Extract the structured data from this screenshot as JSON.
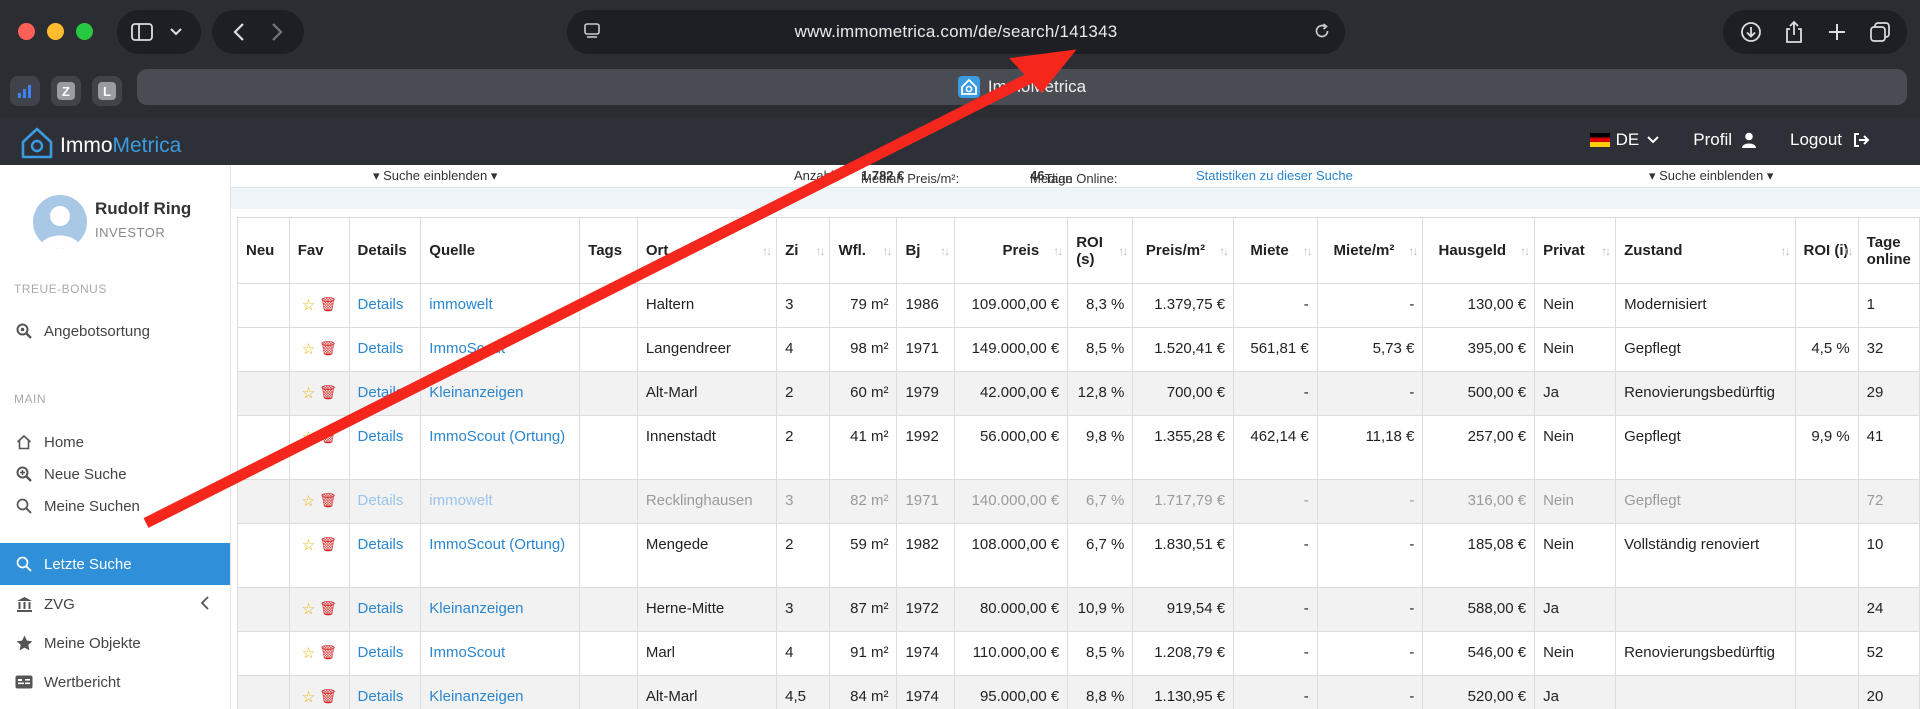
{
  "browser": {
    "url": "www.immometrica.com/de/search/141343",
    "tab_title": "ImmoMetrica",
    "favorites": [
      {
        "label": ""
      },
      {
        "label": "Z"
      },
      {
        "label": "L"
      }
    ]
  },
  "header": {
    "logo_prefix": "Immo",
    "logo_suffix": "Metrica",
    "language": "DE",
    "profile": "Profil",
    "logout": "Logout"
  },
  "sidebar": {
    "user_name": "Rudolf Ring",
    "user_role": "INVESTOR",
    "section_bonus": "TREUE-BONUS",
    "section_main": "MAIN",
    "items": [
      {
        "label": "Angebotsortung",
        "icon": "search-location-icon"
      },
      {
        "label": "Home",
        "icon": "home-icon"
      },
      {
        "label": "Neue Suche",
        "icon": "search-plus-icon"
      },
      {
        "label": "Meine Suchen",
        "icon": "search-icon"
      },
      {
        "label": "Letzte Suche",
        "icon": "search-icon"
      },
      {
        "label": "ZVG",
        "icon": "bank-icon"
      },
      {
        "label": "Meine Objekte",
        "icon": "star-icon"
      },
      {
        "label": "Wertbericht",
        "icon": "id-card-icon"
      }
    ]
  },
  "infobar": {
    "toggle_left": "▾ Suche einblenden ▾",
    "count": "Anzahl",
    "median_price_label": "Median Preis/m²:",
    "median_price_value": "1.782 €",
    "median_online_label": "Median Online:",
    "median_online_value": "46",
    "median_online_unit": "Tage",
    "stats_link": "Statistiken zu dieser Suche",
    "toggle_right": "▾ Suche einblenden ▾"
  },
  "table": {
    "columns": [
      "Neu",
      "Fav",
      "Details",
      "Quelle",
      "Tags",
      "Ort",
      "Zi",
      "Wfl.",
      "Bj",
      "Preis",
      "ROI (s)",
      "Preis/m²",
      "Miete",
      "Miete/m²",
      "Hausgeld",
      "Privat",
      "Zustand",
      "ROI (i)",
      "Tage online"
    ],
    "rows": [
      {
        "details": "Details",
        "quelle": "immowelt",
        "ort": "Haltern",
        "zi": "3",
        "wfl": "79 m²",
        "bj": "1986",
        "preis": "109.000,00 €",
        "roi_s": "8,3 %",
        "preis_m2": "1.379,75 €",
        "miete": "-",
        "miete_m2": "-",
        "hausgeld": "130,00 €",
        "privat": "Nein",
        "zustand": "Modernisiert",
        "roi_i": "",
        "tage": "1"
      },
      {
        "details": "Details",
        "quelle": "ImmoScout",
        "ort": "Langendreer",
        "zi": "4",
        "wfl": "98 m²",
        "bj": "1971",
        "preis": "149.000,00 €",
        "roi_s": "8,5 %",
        "preis_m2": "1.520,41 €",
        "miete": "561,81 €",
        "miete_m2": "5,73 €",
        "hausgeld": "395,00 €",
        "privat": "Nein",
        "zustand": "Gepflegt",
        "roi_i": "4,5 %",
        "tage": "32"
      },
      {
        "details": "Details",
        "quelle": "Kleinanzeigen",
        "ort": "Alt-Marl",
        "zi": "2",
        "wfl": "60 m²",
        "bj": "1979",
        "preis": "42.000,00 €",
        "roi_s": "12,8 %",
        "preis_m2": "700,00 €",
        "miete": "-",
        "miete_m2": "-",
        "hausgeld": "500,00 €",
        "privat": "Ja",
        "zustand": "Renovierungsbedürftig",
        "roi_i": "",
        "tage": "29"
      },
      {
        "details": "Details",
        "quelle": "ImmoScout (Ortung)",
        "ort": "Innenstadt",
        "zi": "2",
        "wfl": "41 m²",
        "bj": "1992",
        "preis": "56.000,00 €",
        "roi_s": "9,8 %",
        "preis_m2": "1.355,28 €",
        "miete": "462,14 €",
        "miete_m2": "11,18 €",
        "hausgeld": "257,00 €",
        "privat": "Nein",
        "zustand": "Gepflegt",
        "roi_i": "9,9 %",
        "tage": "41"
      },
      {
        "details": "Details",
        "quelle": "immowelt",
        "ort": "Recklinghausen",
        "zi": "3",
        "wfl": "82 m²",
        "bj": "1971",
        "preis": "140.000,00 €",
        "roi_s": "6,7 %",
        "preis_m2": "1.717,79 €",
        "miete": "-",
        "miete_m2": "-",
        "hausgeld": "316,00 €",
        "privat": "Nein",
        "zustand": "Gepflegt",
        "roi_i": "",
        "tage": "72"
      },
      {
        "details": "Details",
        "quelle": "ImmoScout (Ortung)",
        "ort": "Mengede",
        "zi": "2",
        "wfl": "59 m²",
        "bj": "1982",
        "preis": "108.000,00 €",
        "roi_s": "6,7 %",
        "preis_m2": "1.830,51 €",
        "miete": "-",
        "miete_m2": "-",
        "hausgeld": "185,08 €",
        "privat": "Nein",
        "zustand": "Vollständig renoviert",
        "roi_i": "",
        "tage": "10"
      },
      {
        "details": "Details",
        "quelle": "Kleinanzeigen",
        "ort": "Herne-Mitte",
        "zi": "3",
        "wfl": "87 m²",
        "bj": "1972",
        "preis": "80.000,00 €",
        "roi_s": "10,9 %",
        "preis_m2": "919,54 €",
        "miete": "-",
        "miete_m2": "-",
        "hausgeld": "588,00 €",
        "privat": "Ja",
        "zustand": "",
        "roi_i": "",
        "tage": "24"
      },
      {
        "details": "Details",
        "quelle": "ImmoScout",
        "ort": "Marl",
        "zi": "4",
        "wfl": "91 m²",
        "bj": "1974",
        "preis": "110.000,00 €",
        "roi_s": "8,5 %",
        "preis_m2": "1.208,79 €",
        "miete": "-",
        "miete_m2": "-",
        "hausgeld": "546,00 €",
        "privat": "Nein",
        "zustand": "Renovierungsbedürftig",
        "roi_i": "",
        "tage": "52"
      },
      {
        "details": "Details",
        "quelle": "Kleinanzeigen",
        "ort": "Alt-Marl",
        "zi": "4,5",
        "wfl": "84 m²",
        "bj": "1974",
        "preis": "95.000,00 €",
        "roi_s": "8,8 %",
        "preis_m2": "1.130,95 €",
        "miete": "-",
        "miete_m2": "-",
        "hausgeld": "520,00 €",
        "privat": "Ja",
        "zustand": "",
        "roi_i": "",
        "tage": "20"
      }
    ]
  },
  "colors": {
    "accent": "#2f8fd8",
    "arrow": "#f5261b",
    "chrome": "#2b2d33"
  }
}
